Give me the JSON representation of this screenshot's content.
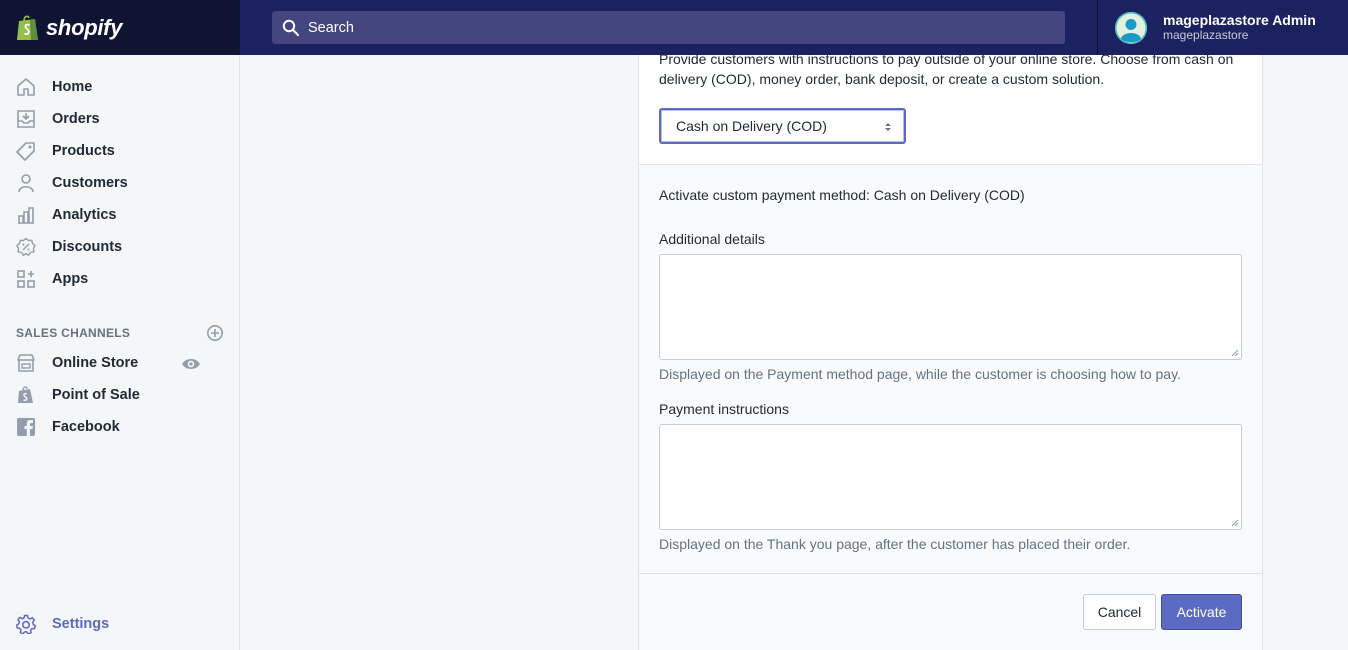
{
  "topbar": {
    "brand": "shopify",
    "search_placeholder": "Search",
    "user_name": "mageplazastore Admin",
    "user_store": "mageplazastore"
  },
  "sidebar": {
    "items": [
      {
        "label": "Home",
        "icon": "home-icon"
      },
      {
        "label": "Orders",
        "icon": "orders-icon"
      },
      {
        "label": "Products",
        "icon": "tag-icon"
      },
      {
        "label": "Customers",
        "icon": "person-icon"
      },
      {
        "label": "Analytics",
        "icon": "bar-chart-icon"
      },
      {
        "label": "Discounts",
        "icon": "discount-icon"
      },
      {
        "label": "Apps",
        "icon": "apps-icon"
      }
    ],
    "sales_channels_title": "SALES CHANNELS",
    "channels": [
      {
        "label": "Online Store",
        "icon": "store-icon"
      },
      {
        "label": "Point of Sale",
        "icon": "shopify-bag-icon"
      },
      {
        "label": "Facebook",
        "icon": "facebook-icon"
      }
    ],
    "settings_label": "Settings",
    "accent_color": "#5c6ac4"
  },
  "main": {
    "description": "Provide customers with instructions to pay outside of your online store. Choose from cash on delivery (COD), money order, bank deposit, or create a custom solution.",
    "select_value": "Cash on Delivery (COD)",
    "activate_title": "Activate custom payment method: Cash on Delivery (COD)",
    "additional_details_label": "Additional details",
    "additional_details_help": "Displayed on the Payment method page, while the customer is choosing how to pay.",
    "payment_instructions_label": "Payment instructions",
    "payment_instructions_help": "Displayed on the Thank you page, after the customer has placed their order.",
    "cancel_label": "Cancel",
    "activate_label": "Activate"
  }
}
